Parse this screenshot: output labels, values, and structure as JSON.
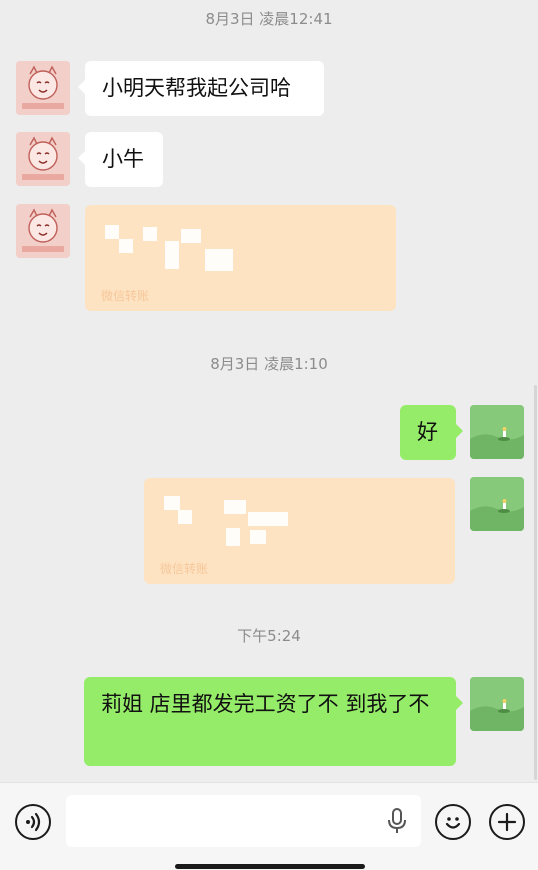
{
  "chat": {
    "separators": [
      {
        "text": "8月3日 凌晨12:41"
      },
      {
        "text": "8月3日 凌晨1:10"
      },
      {
        "text": "下午5:24"
      }
    ],
    "messages": [
      {
        "text": "小明天帮我起公司哈"
      },
      {
        "text": "小牛"
      },
      {
        "transfer_label": "微信转账"
      },
      {
        "text": "好"
      },
      {
        "transfer_label": "微信转账"
      },
      {
        "text": "莉姐 店里都发完工资了不 到我了不"
      }
    ]
  },
  "colors": {
    "sent_bubble": "#95ec69",
    "received_bubble": "#ffffff",
    "transfer_bubble": "#fde3c2",
    "background": "#ededed"
  },
  "icons": {
    "contact_avatar": "dragon-sticker-avatar",
    "self_avatar": "green-landscape-avatar",
    "voice": "voice-icon",
    "mic": "mic-icon",
    "emoji": "emoji-icon",
    "more": "plus-icon"
  }
}
